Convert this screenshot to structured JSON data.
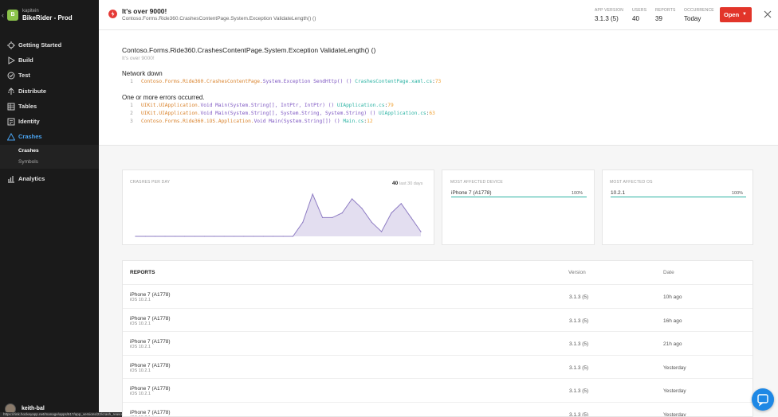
{
  "app": {
    "owner": "kapitein",
    "name": "BikeRider - Prod",
    "icon_letter": "B"
  },
  "nav": [
    {
      "label": "Getting Started",
      "icon": "getting-started-icon"
    },
    {
      "label": "Build",
      "icon": "play-icon"
    },
    {
      "label": "Test",
      "icon": "check-circle-icon"
    },
    {
      "label": "Distribute",
      "icon": "distribute-icon"
    },
    {
      "label": "Tables",
      "icon": "table-icon"
    },
    {
      "label": "Identity",
      "icon": "identity-icon"
    },
    {
      "label": "Crashes",
      "icon": "warning-icon"
    },
    {
      "label": "Analytics",
      "icon": "analytics-icon"
    }
  ],
  "crashes_sub": [
    "Crashes",
    "Symbols"
  ],
  "user": {
    "name": "keith-bal"
  },
  "status_url": "https://rink.hockeyapp.net/manage/apps/617/app_versions/22/crash_reasons/53290113?type=overview",
  "header": {
    "title": "It's over 9000!",
    "subtitle": "Contoso.Forms.Ride360.CrashesContentPage.System.Exception ValidateLength() ()",
    "stats": [
      {
        "key": "APP VERSION",
        "value": "3.1.3 (5)"
      },
      {
        "key": "USERS",
        "value": "40"
      },
      {
        "key": "REPORTS",
        "value": "39"
      },
      {
        "key": "OCCURRENCE",
        "value": "Today"
      }
    ],
    "open_label": "Open"
  },
  "trace": {
    "title": "Contoso.Forms.Ride360.CrashesContentPage.System.Exception ValidateLength() ()",
    "subtitle": "It's over 9000!",
    "groups": [
      {
        "title": "Network down",
        "lines": [
          {
            "n": "1",
            "ns": "Contoso.Forms.Ride360.CrashesContentPage.",
            "method": "System.Exception SendHttp() ()",
            "file": "CrashesContentPage.xaml.cs",
            "line": "73"
          }
        ]
      },
      {
        "title": "One or more errors occurred.",
        "lines": [
          {
            "n": "1",
            "ns": "UIKit.UIApplication.",
            "method": "Void Main(System.String[], IntPtr, IntPtr) ()",
            "file": "UIApplication.cs",
            "line": "79"
          },
          {
            "n": "2",
            "ns": "UIKit.UIApplication.",
            "method": "Void Main(System.String[], System.String, System.String) ()",
            "file": "UIApplication.cs",
            "line": "63"
          },
          {
            "n": "3",
            "ns": "Contoso.Forms.Ride360.iOS.Application.",
            "method": "Void Main(System.String[]) ()",
            "file": "Main.cs",
            "line": "12"
          }
        ]
      }
    ]
  },
  "crashes_card": {
    "heading": "CRASHES PER DAY",
    "total": "40",
    "range": "last 30 days"
  },
  "chart_data": {
    "type": "area",
    "x": [
      1,
      2,
      3,
      4,
      5,
      6,
      7,
      8,
      9,
      10,
      11,
      12,
      13,
      14,
      15,
      16,
      17,
      18,
      19,
      20,
      21,
      22,
      23,
      24,
      25,
      26,
      27,
      28,
      29,
      30
    ],
    "values": [
      0,
      0,
      0,
      0,
      0,
      0,
      0,
      0,
      0,
      0,
      0,
      0,
      0,
      0,
      0,
      0,
      0,
      3,
      9,
      4,
      4,
      5,
      8,
      6,
      3,
      1,
      5,
      7,
      4,
      1
    ],
    "color": "#8e7cc3"
  },
  "device_card": {
    "heading": "MOST AFFECTED DEVICE",
    "label": "iPhone 7 (A1778)",
    "percent": "100%",
    "fill": 1.0
  },
  "os_card": {
    "heading": "MOST AFFECTED OS",
    "label": "10.2.1",
    "percent": "100%",
    "fill": 1.0
  },
  "reports": {
    "heading": "REPORTS",
    "col_version": "Version",
    "col_date": "Date",
    "rows": [
      {
        "device": "iPhone 7 (A1778)",
        "os": "iOS 10.2.1",
        "version": "3.1.3 (5)",
        "date": "10h ago"
      },
      {
        "device": "iPhone 7 (A1778)",
        "os": "iOS 10.2.1",
        "version": "3.1.3 (5)",
        "date": "16h ago"
      },
      {
        "device": "iPhone 7 (A1778)",
        "os": "iOS 10.2.1",
        "version": "3.1.3 (5)",
        "date": "21h ago"
      },
      {
        "device": "iPhone 7 (A1778)",
        "os": "iOS 10.2.1",
        "version": "3.1.3 (5)",
        "date": "Yesterday"
      },
      {
        "device": "iPhone 7 (A1778)",
        "os": "iOS 10.2.1",
        "version": "3.1.3 (5)",
        "date": "Yesterday"
      },
      {
        "device": "iPhone 7 (A1778)",
        "os": "iOS 10.2.1",
        "version": "3.1.3 (5)",
        "date": "Yesterday"
      }
    ]
  }
}
